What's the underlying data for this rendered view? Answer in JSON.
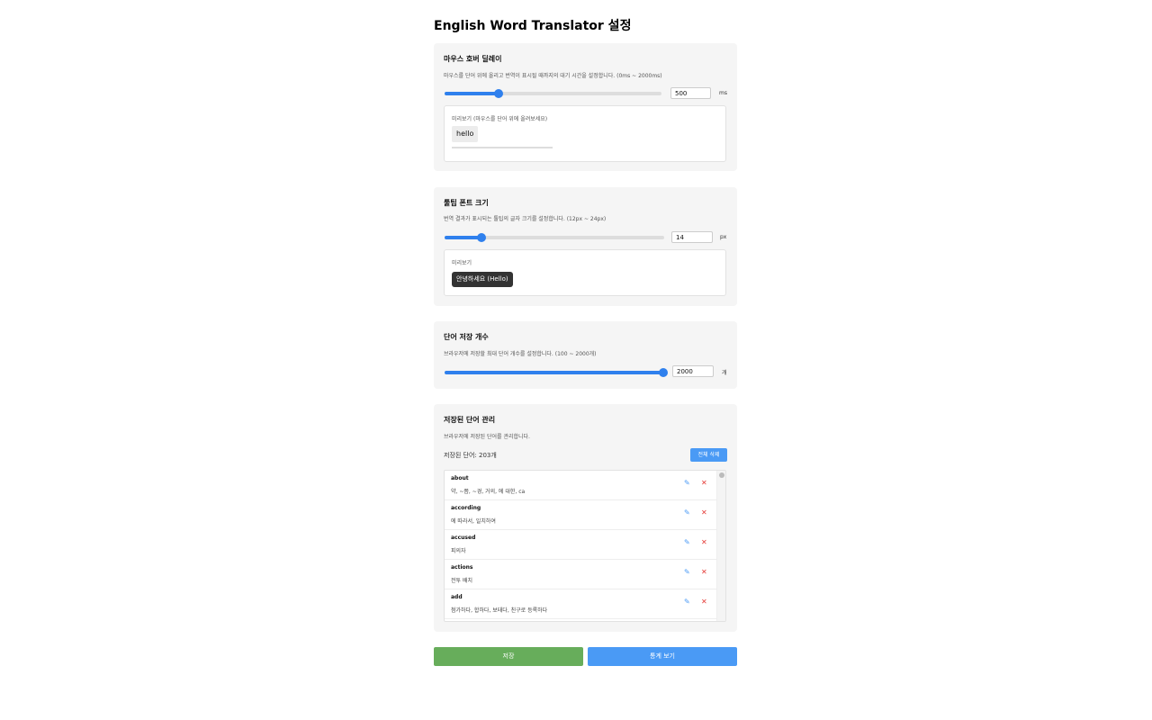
{
  "page_title": "English Word Translator 설정",
  "hover_delay": {
    "title": "마우스 호버 딜레이",
    "description": "마우스를 단어 위에 올리고 번역이 표시될 때까지의 대기 시간을 설정합니다. (0ms ~ 2000ms)",
    "value": "500",
    "unit": "ms",
    "slider_fraction": 0.25,
    "preview_label": "미리보기 (마우스를 단어 위에 올려보세요)",
    "preview_word": "hello"
  },
  "font_size": {
    "title": "툴팁 폰트 크기",
    "description": "번역 결과가 표시되는 툴팁의 글자 크기를 설정합니다. (12px ~ 24px)",
    "value": "14",
    "unit": "px",
    "slider_fraction": 0.1667,
    "preview_label": "미리보기",
    "tooltip_text": "안녕하세요 (Hello)"
  },
  "word_count": {
    "title": "단어 저장 개수",
    "description": "브라우저에 저장할 최대 단어 개수를 설정합니다. (100 ~ 2000개)",
    "value": "2000",
    "unit": "개",
    "slider_fraction": 1.0
  },
  "saved_words": {
    "title": "저장된 단어 관리",
    "description": "브라우저에 저장된 단어를 관리합니다.",
    "count_text": "저장된 단어: 203개",
    "delete_all_label": "전체 삭제",
    "items": [
      {
        "word": "about",
        "meaning": "약, ~쯤, ~경, 거의, 에 대한, ca"
      },
      {
        "word": "according",
        "meaning": "에 따라서, 일치하여"
      },
      {
        "word": "accused",
        "meaning": "피의자"
      },
      {
        "word": "actions",
        "meaning": "전투 배치"
      },
      {
        "word": "add",
        "meaning": "첨가하다, 합하다, 보태다, 친구로 등록하다"
      }
    ],
    "edit_icon": "pencil-icon",
    "delete_icon": "close-icon"
  },
  "buttons": {
    "save_label": "저장",
    "stats_label": "통계 보기",
    "save_color": "#67ad5b",
    "stats_color": "#4a9af5"
  },
  "accent_color": "#2f80ed"
}
